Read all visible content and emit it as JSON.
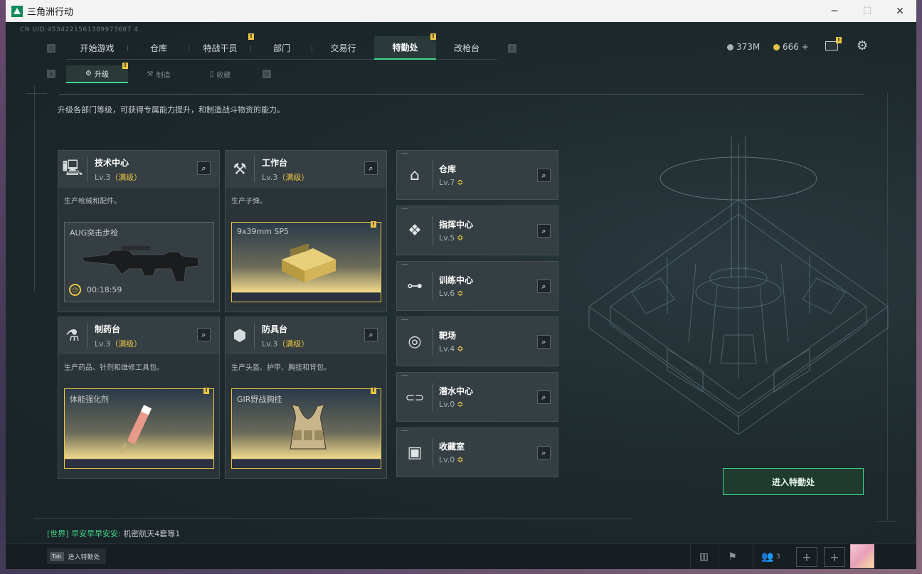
{
  "window": {
    "title": "三角洲行动",
    "controls": [
      "─",
      "☐",
      "✕"
    ]
  },
  "uid": "CN UID:4534221561389973687 4",
  "nav": {
    "left_key": "Q",
    "right_key": "E",
    "tabs": [
      {
        "label": "开始游戏",
        "active": false,
        "badge": ""
      },
      {
        "label": "仓库",
        "active": false,
        "badge": ""
      },
      {
        "label": "特战干员",
        "active": false,
        "badge": "!"
      },
      {
        "label": "部门",
        "active": false,
        "badge": ""
      },
      {
        "label": "交易行",
        "active": false,
        "badge": ""
      },
      {
        "label": "特勤处",
        "active": true,
        "badge": "!"
      },
      {
        "label": "改枪台",
        "active": false,
        "badge": ""
      }
    ]
  },
  "resources": {
    "money": "373M",
    "coins": "666 +",
    "mail_badge": "!"
  },
  "subnav": {
    "left_key": "A",
    "right_key": "D",
    "tabs": [
      {
        "label": "升级",
        "icon": "⚙",
        "active": true,
        "badge": "!"
      },
      {
        "label": "制造",
        "icon": "⚒",
        "active": false,
        "badge": ""
      },
      {
        "label": "收藏",
        "icon": "▯",
        "active": false,
        "badge": ""
      }
    ]
  },
  "description": "升级各部门等级，可获得专属能力提升，和制造战斗物资的能力。",
  "cards": [
    {
      "name": "技术中心",
      "level": "Lv.3",
      "max": "（满级）",
      "icon": "computer-icon",
      "glyph": "🖳",
      "desc": "生产枪械和配件。",
      "craft_name": "AUG突击步枪",
      "craft_timer": "00:18:59",
      "ready": false,
      "badge": ""
    },
    {
      "name": "工作台",
      "level": "Lv.3",
      "max": "（满级）",
      "icon": "tools-icon",
      "glyph": "⚒",
      "desc": "生产子弹。",
      "craft_name": "9x39mm SP5",
      "craft_timer": "",
      "ready": true,
      "badge": "!"
    },
    {
      "name": "制药台",
      "level": "Lv.3",
      "max": "（满级）",
      "icon": "microscope-icon",
      "glyph": "⚗",
      "desc": "生产药品、针剂和维修工具包。",
      "craft_name": "体能强化剂",
      "craft_timer": "",
      "ready": true,
      "badge": "!"
    },
    {
      "name": "防具台",
      "level": "Lv.3",
      "max": "（满级）",
      "icon": "armor-icon",
      "glyph": "⬢",
      "desc": "生产头盔、护甲、胸挂和背包。",
      "craft_name": "GIR野战胸挂",
      "craft_timer": "",
      "ready": true,
      "badge": "!"
    }
  ],
  "departments": [
    {
      "name": "仓库",
      "level": "Lv.7",
      "icon": "warehouse-icon",
      "glyph": "⌂"
    },
    {
      "name": "指挥中心",
      "level": "Lv.5",
      "icon": "command-icon",
      "glyph": "❖"
    },
    {
      "name": "训练中心",
      "level": "Lv.6",
      "icon": "dumbbell-icon",
      "glyph": "⊶"
    },
    {
      "name": "靶场",
      "level": "Lv.4",
      "icon": "target-icon",
      "glyph": "◎"
    },
    {
      "name": "潜水中心",
      "level": "Lv.0",
      "icon": "diving-mask-icon",
      "glyph": "⊂⊃"
    },
    {
      "name": "收藏室",
      "level": "Lv.0",
      "icon": "collection-icon",
      "glyph": "▣"
    }
  ],
  "up_glyph": "≎",
  "enter_button": "进入特勤处",
  "chat": {
    "channel": "[世界]",
    "user": "早安早早安安:",
    "message": "机密航天4套等1"
  },
  "bottom": {
    "tab_key": "Tab",
    "tab_label": "进入特勤处",
    "team_count": "3"
  },
  "accent": "#3fd58a",
  "gold": "#e8c547"
}
